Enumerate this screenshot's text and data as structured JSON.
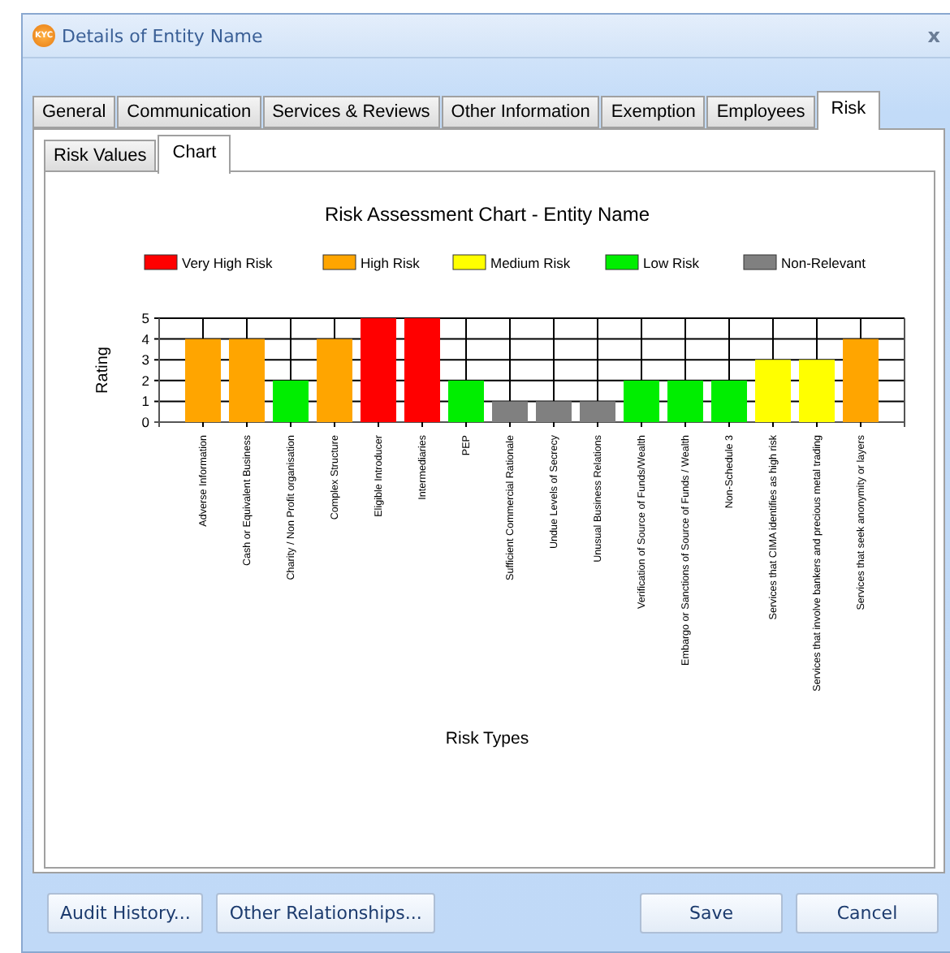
{
  "window": {
    "title": "Details of Entity Name",
    "logo": "KYC",
    "close": "x"
  },
  "tabs": [
    {
      "label": "General",
      "selected": false
    },
    {
      "label": "Communication",
      "selected": false
    },
    {
      "label": "Services & Reviews",
      "selected": false
    },
    {
      "label": "Other Information",
      "selected": false
    },
    {
      "label": "Exemption",
      "selected": false
    },
    {
      "label": "Employees",
      "selected": false
    },
    {
      "label": "Risk",
      "selected": true
    }
  ],
  "subtabs": [
    {
      "label": "Risk Values",
      "selected": false
    },
    {
      "label": "Chart",
      "selected": true
    }
  ],
  "chart_data": {
    "type": "bar",
    "title": "Risk Assessment Chart - Entity Name",
    "xlabel": "Risk Types",
    "ylabel": "Rating",
    "grid": true,
    "legend": "top",
    "ylim": [
      0,
      5
    ],
    "yticks": [
      0,
      1,
      2,
      3,
      4,
      5
    ],
    "categories": [
      "Adverse Information",
      "Cash or Equivalent Business",
      "Charity / Non Profit organisation",
      "Complex Structure",
      "Eligible Introducer",
      "Intermediaries",
      "PEP",
      "Sufficient Commercial Rationale",
      "Undue Levels of Secrecy",
      "Unusual Business Relations",
      "Verification of Source of Funds/Wealth",
      "Embargo or Sanctions of Source of Funds / Wealth",
      "Non-Schedule 3",
      "Services that CIMA identifies as high risk",
      "Services that involve bankers and precious metal trading",
      "Services that seek anonymity or layers"
    ],
    "series": [
      {
        "name": "Very High Risk",
        "color": "#ff0000",
        "values": [
          null,
          null,
          null,
          null,
          5,
          5,
          null,
          null,
          null,
          null,
          null,
          null,
          null,
          null,
          null,
          null
        ]
      },
      {
        "name": "High Risk",
        "color": "#ffa500",
        "values": [
          4,
          4,
          null,
          4,
          null,
          null,
          null,
          null,
          null,
          null,
          null,
          null,
          null,
          null,
          null,
          4
        ]
      },
      {
        "name": "Medium Risk",
        "color": "#ffff00",
        "values": [
          null,
          null,
          null,
          null,
          null,
          null,
          null,
          null,
          null,
          null,
          null,
          null,
          null,
          3,
          3,
          null
        ]
      },
      {
        "name": "Low Risk",
        "color": "#00ee00",
        "values": [
          null,
          null,
          2,
          null,
          null,
          null,
          2,
          null,
          null,
          null,
          2,
          2,
          2,
          null,
          null,
          null
        ]
      },
      {
        "name": "Non-Relevant",
        "color": "#808080",
        "values": [
          null,
          null,
          null,
          null,
          null,
          null,
          null,
          1,
          1,
          1,
          null,
          null,
          null,
          null,
          null,
          null
        ]
      }
    ]
  },
  "buttons_left": [
    "Audit History...",
    "Other Relationships..."
  ],
  "buttons_right": [
    "Save",
    "Cancel"
  ]
}
